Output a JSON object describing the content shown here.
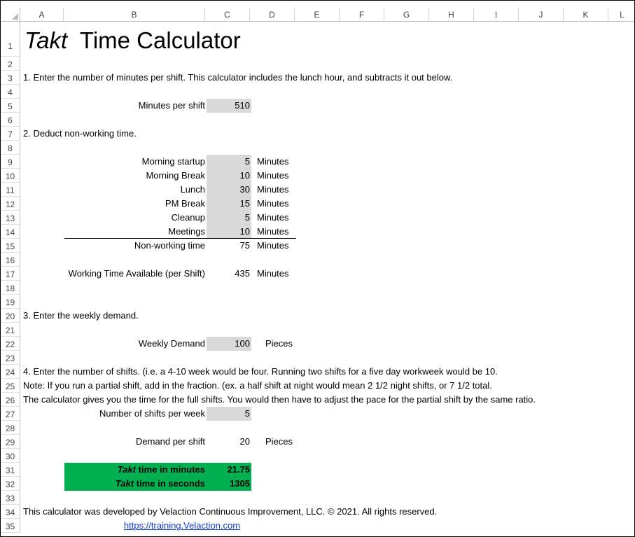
{
  "columns": [
    "A",
    "B",
    "C",
    "D",
    "E",
    "F",
    "G",
    "H",
    "I",
    "J",
    "K",
    "L"
  ],
  "rows": [
    "1",
    "2",
    "3",
    "4",
    "5",
    "6",
    "7",
    "8",
    "9",
    "10",
    "11",
    "12",
    "13",
    "14",
    "15",
    "16",
    "17",
    "18",
    "19",
    "20",
    "21",
    "22",
    "23",
    "24",
    "25",
    "26",
    "27",
    "28",
    "29",
    "30",
    "31",
    "32",
    "33",
    "34",
    "35"
  ],
  "title": {
    "italic": "Takt",
    "rest": "Time Calculator"
  },
  "step1": "1. Enter the number of minutes per shift. This calculator includes the lunch hour, and subtracts it out below.",
  "minutes_per_shift": {
    "label": "Minutes per shift",
    "value": "510"
  },
  "step2": "2. Deduct non-working time.",
  "deductions": [
    {
      "label": "Morning startup",
      "value": "5",
      "unit": "Minutes"
    },
    {
      "label": "Morning Break",
      "value": "10",
      "unit": "Minutes"
    },
    {
      "label": "Lunch",
      "value": "30",
      "unit": "Minutes"
    },
    {
      "label": "PM Break",
      "value": "15",
      "unit": "Minutes"
    },
    {
      "label": "Cleanup",
      "value": "5",
      "unit": "Minutes"
    },
    {
      "label": "Meetings",
      "value": "10",
      "unit": "Minutes"
    }
  ],
  "non_working": {
    "label": "Non-working time",
    "value": "75",
    "unit": "Minutes"
  },
  "working_available": {
    "label": "Working Time Available (per Shift)",
    "value": "435",
    "unit": "Minutes"
  },
  "step3": "3. Enter the weekly demand.",
  "weekly_demand": {
    "label": "Weekly Demand",
    "value": "100",
    "unit": "Pieces"
  },
  "step4": "4. Enter the number of shifts. (i.e. a 4-10 week would be four. Running two shifts for a five day workweek would be 10.",
  "note": "Note: If you run a partial shift, add in the fraction. (ex. a half shift at night would mean 2 1/2 night shifts, or 7 1/2 total.",
  "calc_note": "The calculator gives you the time for the full shifts. You would then have to adjust the pace for the partial shift by the same ratio.",
  "shifts_per_week": {
    "label": "Number of shifts per week",
    "value": "5"
  },
  "demand_per_shift": {
    "label": "Demand per shift",
    "value": "20",
    "unit": "Pieces"
  },
  "takt_minutes": {
    "italic": "Takt",
    "label": " time in minutes",
    "value": "21.75"
  },
  "takt_seconds": {
    "italic": "Takt",
    "label": " time in seconds",
    "value": "1305"
  },
  "footer": "This calculator was developed by Velaction Continuous Improvement, LLC. © 2021. All rights reserved.",
  "link": "https://training.Velaction.com",
  "colors": {
    "gray_fill": "#d9d9d9",
    "green_fill": "#00b050",
    "link": "#0b3bd1"
  }
}
